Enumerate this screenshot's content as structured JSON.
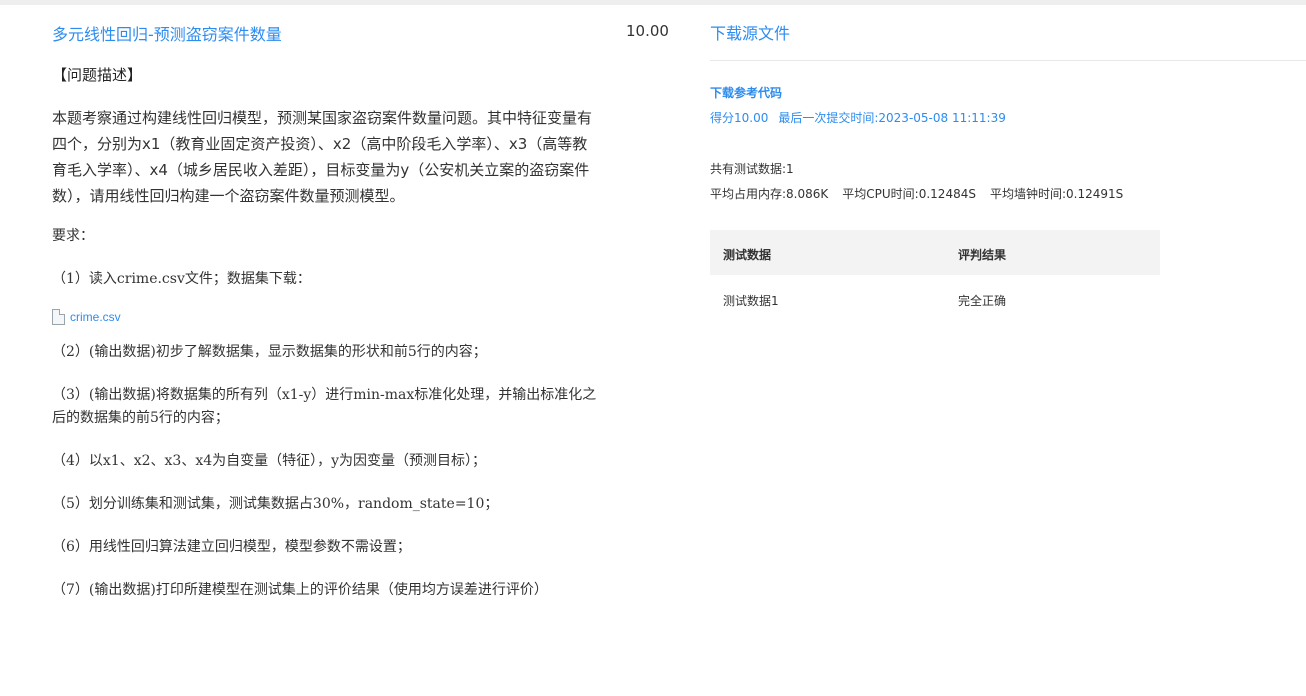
{
  "problem": {
    "title": "多元线性回归-预测盗窃案件数量",
    "score": "10.00",
    "section_head": "【问题描述】",
    "description": "本题考察通过构建线性回归模型，预测某国家盗窃案件数量问题。其中特征变量有四个，分别为x1（教育业固定资产投资）、x2（高中阶段毛入学率）、x3（高等教育毛入学率）、x4（城乡居民收入差距），目标变量为y（公安机关立案的盗窃案件数），请用线性回归构建一个盗窃案件数量预测模型。",
    "requirements_label": "要求：",
    "req1": "（1）读入crime.csv文件；数据集下载：",
    "file_name": "crime.csv",
    "req2": "（2）(输出数据)初步了解数据集，显示数据集的形状和前5行的内容；",
    "req3": "（3）(输出数据)将数据集的所有列（x1-y）进行min-max标准化处理，并输出标准化之后的数据集的前5行的内容；",
    "req4": "（4）以x1、x2、x3、x4为自变量（特征），y为因变量（预测目标）；",
    "req5": "（5）划分训练集和测试集，测试集数据占30%，random_state=10；",
    "req6": "（6）用线性回归算法建立回归模型，模型参数不需设置；",
    "req7": "（7）(输出数据)打印所建模型在测试集上的评价结果（使用均方误差进行评价）"
  },
  "panel": {
    "download_source": "下载源文件",
    "download_code": "下载参考代码",
    "score_text": "得分10.00",
    "last_submit": "最后一次提交时间:2023-05-08 11:11:39",
    "test_count": "共有测试数据:1",
    "avg_memory": "平均占用内存:8.086K",
    "avg_cpu": "平均CPU时间:0.12484S",
    "avg_wall": "平均墙钟时间:0.12491S",
    "table": {
      "col_data": "测试数据",
      "col_result": "评判结果",
      "rows": [
        {
          "data": "测试数据1",
          "result": "完全正确"
        }
      ]
    }
  }
}
